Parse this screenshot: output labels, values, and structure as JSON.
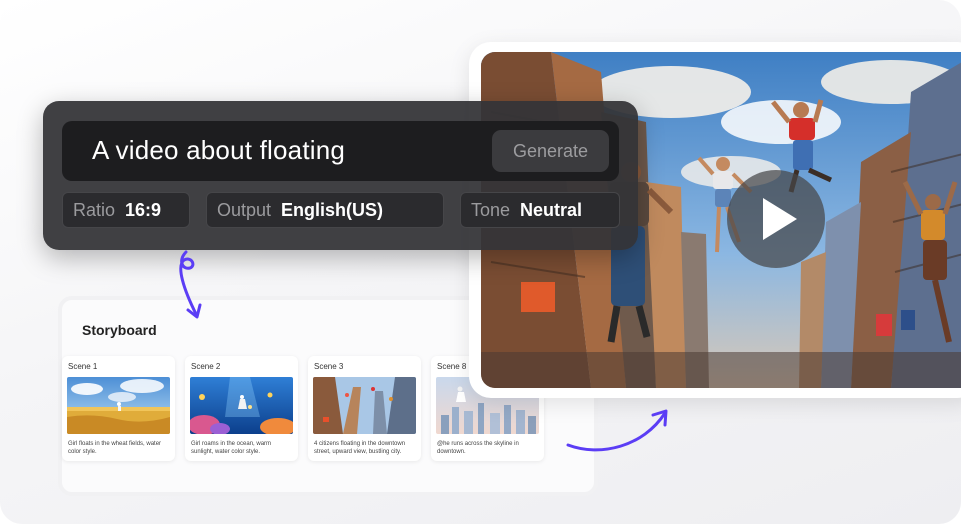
{
  "prompt": {
    "text": "A video about floating",
    "generate_label": "Generate"
  },
  "options": [
    {
      "label": "Ratio",
      "value": "16:9"
    },
    {
      "label": "Output",
      "value": "English(US)"
    },
    {
      "label": "Tone",
      "value": "Neutral"
    }
  ],
  "storyboard": {
    "title": "Storyboard",
    "scenes": [
      {
        "label": "Scene 1",
        "description": "Girl floats in the wheat fields, water color style."
      },
      {
        "label": "Scene 2",
        "description": "Girl roams in the ocean, warm sunlight, water color style."
      },
      {
        "label": "Scene 3",
        "description": "4 citizens floating in the downtown street, upward view, bustling city."
      },
      {
        "label": "Scene 8",
        "description": "@he runs across the skyline in downtown."
      }
    ]
  },
  "colors": {
    "panel_bg": "#343437",
    "input_bg": "#1d1d1f",
    "arrow": "#5b3df5",
    "play_overlay": "#464648"
  },
  "icons": [
    "play-icon",
    "curly-arrow-down-icon",
    "curved-arrow-right-icon"
  ]
}
